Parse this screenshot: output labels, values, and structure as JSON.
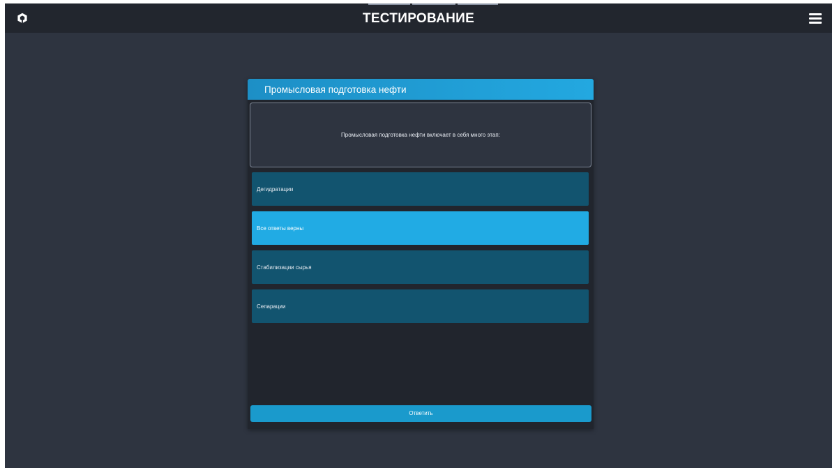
{
  "app": {
    "title": "ТЕСТИРОВАНИЕ",
    "logo_icon": "logo-icon",
    "menu_icon": "hamburger-menu-icon"
  },
  "quiz": {
    "topic": "Промысловая подготовка нефти",
    "question": "Промысловая подготовка нефти включает в себя много этап:",
    "answers": [
      {
        "label": "Дегидратации",
        "selected": false
      },
      {
        "label": "Все ответы верны",
        "selected": true
      },
      {
        "label": "Стабилизации сырья",
        "selected": false
      },
      {
        "label": "Сепарации",
        "selected": false
      }
    ],
    "submit_label": "Ответить"
  },
  "colors": {
    "background": "#2e3440",
    "topbar": "#22262e",
    "accent": "#21abe4",
    "answer_default": "#12546f"
  }
}
